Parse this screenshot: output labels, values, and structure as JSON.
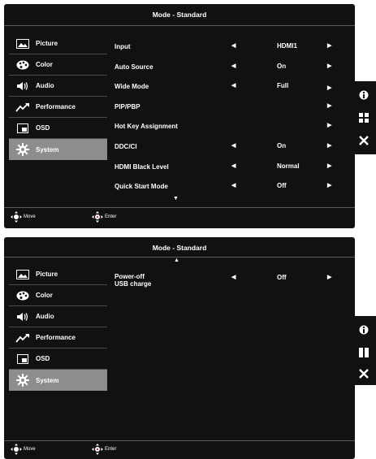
{
  "panel1": {
    "title": "Mode - Standard",
    "sidebar": [
      "Picture",
      "Color",
      "Audio",
      "Performance",
      "OSD",
      "System"
    ],
    "selected": "System",
    "rows": [
      {
        "label": "Input",
        "value": "HDMI1",
        "left_arrow": true,
        "right_arrow": true
      },
      {
        "label": "Auto Source",
        "value": "On",
        "left_arrow": true,
        "right_arrow": true
      },
      {
        "label": "Wide Mode",
        "value": "Full",
        "left_arrow": true,
        "right_arrow": true
      },
      {
        "label": "PIP/PBP",
        "value": "",
        "left_arrow": false,
        "right_arrow": true
      },
      {
        "label": "Hot Key Assignment",
        "value": "",
        "left_arrow": false,
        "right_arrow": true
      },
      {
        "label": "DDC/CI",
        "value": "On",
        "left_arrow": true,
        "right_arrow": true
      },
      {
        "label": "HDMI Black Level",
        "value": "Normal",
        "left_arrow": true,
        "right_arrow": true
      },
      {
        "label": "Quick Start Mode",
        "value": "Off",
        "left_arrow": true,
        "right_arrow": true
      }
    ],
    "footer_move": "Move",
    "footer_enter": "Enter"
  },
  "panel2": {
    "title": "Mode - Standard",
    "sidebar": [
      "Picture",
      "Color",
      "Audio",
      "Performance",
      "OSD",
      "System"
    ],
    "selected": "System",
    "row_label_line1": "Power-off",
    "row_label_line2": "USB charge",
    "row_value": "Off",
    "footer_move": "Move",
    "footer_enter": "Enter"
  },
  "glyphs": {
    "left": "◀",
    "right": "▶",
    "down": "▼",
    "up": "▲"
  },
  "icons": [
    "picture-icon",
    "color-icon",
    "audio-icon",
    "performance-icon",
    "osd-icon",
    "system-icon",
    "info-icon",
    "grid-icon",
    "close-icon"
  ]
}
